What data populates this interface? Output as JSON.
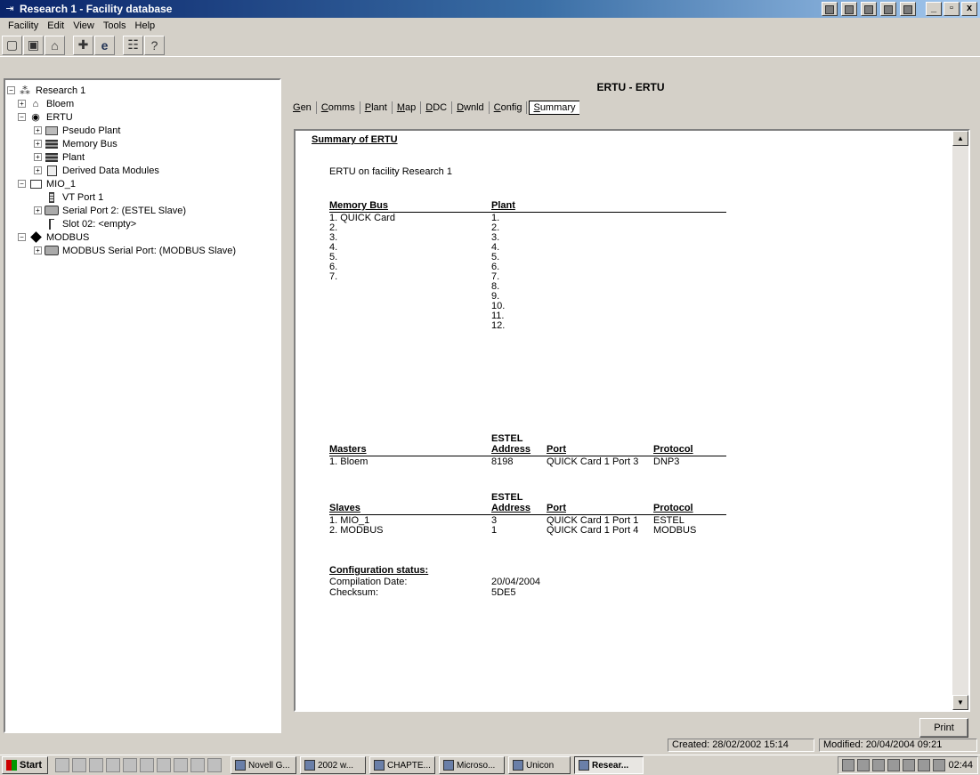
{
  "window": {
    "title": "Research 1 - Facility database",
    "buttons": [
      "_",
      "▫",
      "x"
    ]
  },
  "menu": [
    "Facility",
    "Edit",
    "View",
    "Tools",
    "Help"
  ],
  "toolbar_icons": [
    "new-icon",
    "save-icon",
    "open-folder-icon",
    "plus-icon",
    "internet-explorer-icon",
    "properties-icon",
    "help-icon"
  ],
  "tree": [
    {
      "label": "Research 1",
      "level": 0,
      "expander": "-",
      "icon": "network-icon"
    },
    {
      "label": "Bloem",
      "level": 1,
      "expander": "+",
      "icon": "building-icon"
    },
    {
      "label": "ERTU",
      "level": 1,
      "expander": "-",
      "icon": "rtu-icon"
    },
    {
      "label": "Pseudo Plant",
      "level": 2,
      "expander": "+",
      "icon": "pseudo-plant-icon"
    },
    {
      "label": "Memory Bus",
      "level": 2,
      "expander": "+",
      "icon": "memory-bus-icon"
    },
    {
      "label": "Plant",
      "level": 2,
      "expander": "+",
      "icon": "plant-icon"
    },
    {
      "label": "Derived Data Modules",
      "level": 2,
      "expander": "+",
      "icon": "derived-data-icon"
    },
    {
      "label": "MIO_1",
      "level": 1,
      "expander": "-",
      "icon": "module-icon"
    },
    {
      "label": "VT Port 1",
      "level": 2,
      "expander": "",
      "icon": "port-icon"
    },
    {
      "label": "Serial Port 2: (ESTEL Slave)",
      "level": 2,
      "expander": "+",
      "icon": "serial-port-icon"
    },
    {
      "label": "Slot 02: <empty>",
      "level": 2,
      "expander": "",
      "icon": "slot-icon"
    },
    {
      "label": "MODBUS",
      "level": 1,
      "expander": "-",
      "icon": "diamond-icon"
    },
    {
      "label": "MODBUS Serial Port: (MODBUS Slave)",
      "level": 2,
      "expander": "+",
      "icon": "serial-port-icon"
    }
  ],
  "panel": {
    "header": "ERTU - ERTU",
    "tabs": [
      {
        "u": "G",
        "rest": "en"
      },
      {
        "u": "C",
        "rest": "omms"
      },
      {
        "u": "P",
        "rest": "lant"
      },
      {
        "u": "M",
        "rest": "ap"
      },
      {
        "u": "D",
        "rest": "DC"
      },
      {
        "u": "D",
        "rest": "wnld"
      },
      {
        "u": "C",
        "rest": "onfig"
      },
      {
        "u": "S",
        "rest": "ummary"
      }
    ],
    "active_tab": "Summary"
  },
  "summary": {
    "title": "Summary of ERTU",
    "subtitle": "ERTU on facility Research 1",
    "memory_bus_header": "Memory Bus",
    "plant_header": "Plant",
    "memory_bus": [
      "1. QUICK Card",
      "2.",
      "3.",
      "4.",
      "5.",
      "6.",
      "7."
    ],
    "plant": [
      "1.",
      "2.",
      "3.",
      "4.",
      "5.",
      "6.",
      "7.",
      "8.",
      "9.",
      "10.",
      "11.",
      "12."
    ],
    "masters": {
      "headers": [
        "Masters",
        "ESTEL",
        "Address",
        "Port",
        "Protocol"
      ],
      "rows": [
        [
          "1. Bloem",
          "8198",
          "QUICK Card 1 Port 3",
          "DNP3"
        ]
      ]
    },
    "slaves": {
      "headers": [
        "Slaves",
        "ESTEL",
        "Address",
        "Port",
        "Protocol"
      ],
      "rows": [
        [
          "1. MIO_1",
          "3",
          "QUICK Card 1 Port 1",
          "ESTEL"
        ],
        [
          "2. MODBUS",
          "1",
          "QUICK Card 1 Port 4",
          "MODBUS"
        ]
      ]
    },
    "config": {
      "title": "Configuration status:",
      "compilation_label": "Compilation Date:",
      "compilation_value": "20/04/2004",
      "checksum_label": "Checksum:",
      "checksum_value": "5DE5"
    }
  },
  "print_label": "Print",
  "status": {
    "created": "Created: 28/02/2002 15:14",
    "modified": "Modified: 20/04/2004 09:21"
  },
  "taskbar": {
    "start": "Start",
    "tasks": [
      "Novell G...",
      "2002 w...",
      "CHAPTE...",
      "Microso...",
      "Unicon",
      "Resear..."
    ],
    "clock": "02:44"
  }
}
